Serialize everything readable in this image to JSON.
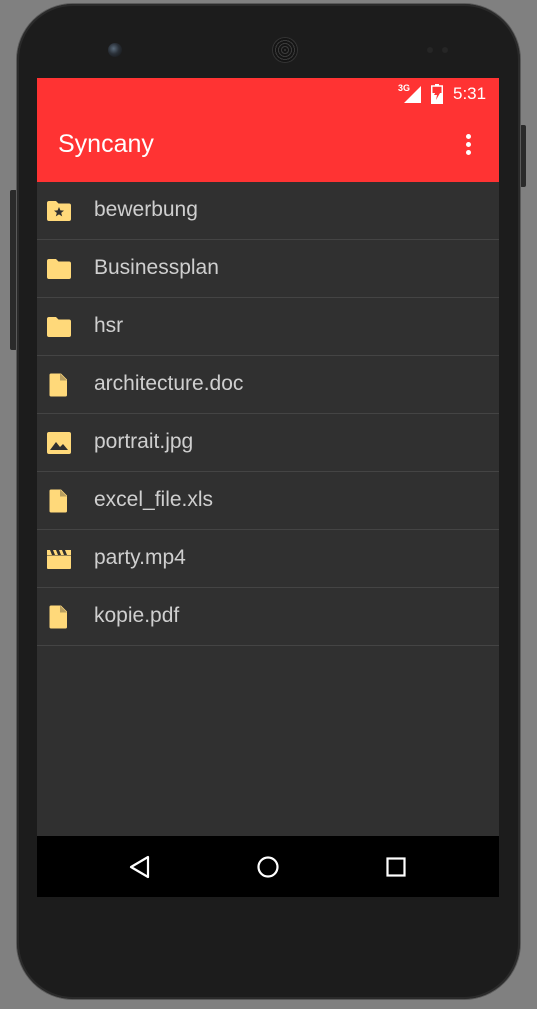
{
  "status_bar": {
    "network_type": "3G",
    "time": "5:31",
    "signal_icon": "cell-signal-icon",
    "battery_icon": "battery-charging-icon"
  },
  "app_bar": {
    "title": "Syncany",
    "menu_icon": "more-vert-icon"
  },
  "colors": {
    "accent": "#ff3333",
    "background": "#303030",
    "icon": "#ffd97a",
    "text": "#cfcfcf",
    "divider": "#444444"
  },
  "files": [
    {
      "name": "bewerbung",
      "icon": "folder-star-icon"
    },
    {
      "name": "Businessplan",
      "icon": "folder-icon"
    },
    {
      "name": "hsr",
      "icon": "folder-icon"
    },
    {
      "name": "architecture.doc",
      "icon": "file-icon"
    },
    {
      "name": "portrait.jpg",
      "icon": "image-icon"
    },
    {
      "name": "excel_file.xls",
      "icon": "file-icon"
    },
    {
      "name": "party.mp4",
      "icon": "movie-icon"
    },
    {
      "name": "kopie.pdf",
      "icon": "file-icon"
    }
  ],
  "nav_bar": {
    "back_icon": "back-icon",
    "home_icon": "home-icon",
    "recents_icon": "recents-icon"
  }
}
